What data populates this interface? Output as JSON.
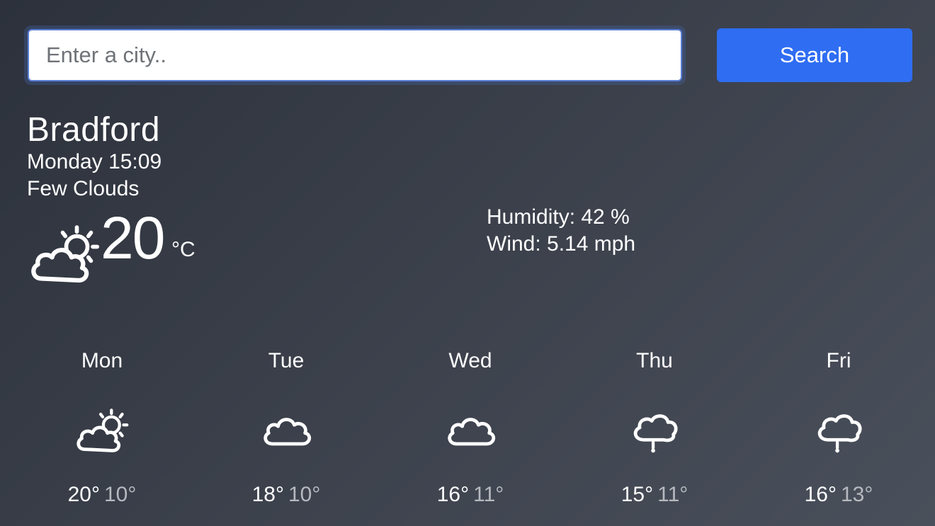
{
  "search": {
    "placeholder": "Enter a city..",
    "value": "",
    "button_label": "Search"
  },
  "current": {
    "city": "Bradford",
    "datetime": "Monday 15:09",
    "condition": "Few Clouds",
    "temperature": "20",
    "unit": "°C",
    "icon": "partly-cloudy-icon",
    "humidity": "Humidity: 42 %",
    "wind": "Wind: 5.14 mph"
  },
  "forecast": [
    {
      "day": "Mon",
      "icon": "partly-cloudy-icon",
      "high": "20°",
      "low": "10°"
    },
    {
      "day": "Tue",
      "icon": "cloud-icon",
      "high": "18°",
      "low": "10°"
    },
    {
      "day": "Wed",
      "icon": "cloud-icon",
      "high": "16°",
      "low": "11°"
    },
    {
      "day": "Thu",
      "icon": "rain-cloud-icon",
      "high": "15°",
      "low": "11°"
    },
    {
      "day": "Fri",
      "icon": "rain-cloud-icon",
      "high": "16°",
      "low": "13°"
    }
  ],
  "colors": {
    "accent": "#2f6df2",
    "low_temp": "#b6b9be",
    "background": "#343943"
  }
}
